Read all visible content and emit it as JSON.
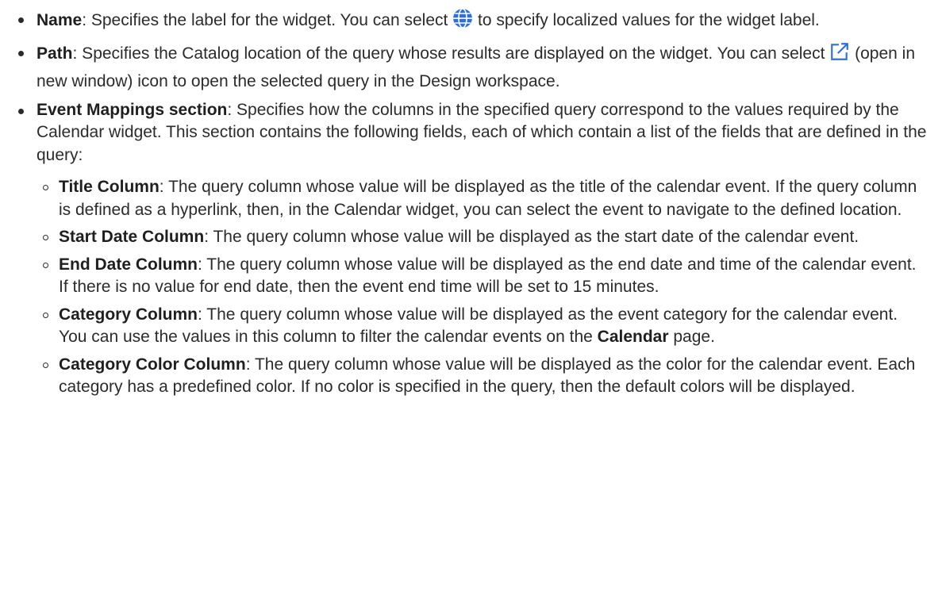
{
  "items": [
    {
      "term": "Name",
      "text_before_icon": ": Specifies the label for the widget. You can select ",
      "icon": "globe-icon",
      "text_after_icon": " to specify localized values for the widget label."
    },
    {
      "term": "Path",
      "text_before_icon": ": Specifies the Catalog location of the query whose results are displayed on the widget. You can select ",
      "icon": "open-in-new-window-icon",
      "text_after_icon": " (open in new window) icon to open the selected query in the Design workspace."
    },
    {
      "term": "Event Mappings section",
      "text": ": Specifies how the columns in the specified query correspond to the values required by the Calendar widget. This section contains the following fields, each of which contain a list of the fields that are defined in the query:",
      "subitems": [
        {
          "term": "Title Column",
          "text": ": The query column whose value will be displayed as the title of the calendar event. If the query column is defined as a hyperlink, then, in the Calendar widget, you can select the event to navigate to the defined location."
        },
        {
          "term": "Start Date Column",
          "text": ": The query column whose value will be displayed as the start date of the calendar event."
        },
        {
          "term": "End Date Column",
          "text": ": The query column whose value will be displayed as the end date and time of the calendar event. If there is no value for end date, then the event end time will be set to 15 minutes."
        },
        {
          "term": "Category Column",
          "text_before_bold": ": The query column whose value will be displayed as the event category for the calendar event. You can use the values in this column to filter the calendar events on the ",
          "bold": "Calendar",
          "text_after_bold": " page."
        },
        {
          "term": "Category Color Column",
          "text": ": The query column whose value will be displayed as the color for the calendar event. Each category has a predefined color. If no color is specified in the query, then the default colors will be displayed."
        }
      ]
    }
  ],
  "colors": {
    "text": "#2b2b2b",
    "icon_blue": "#2f6fdb"
  }
}
